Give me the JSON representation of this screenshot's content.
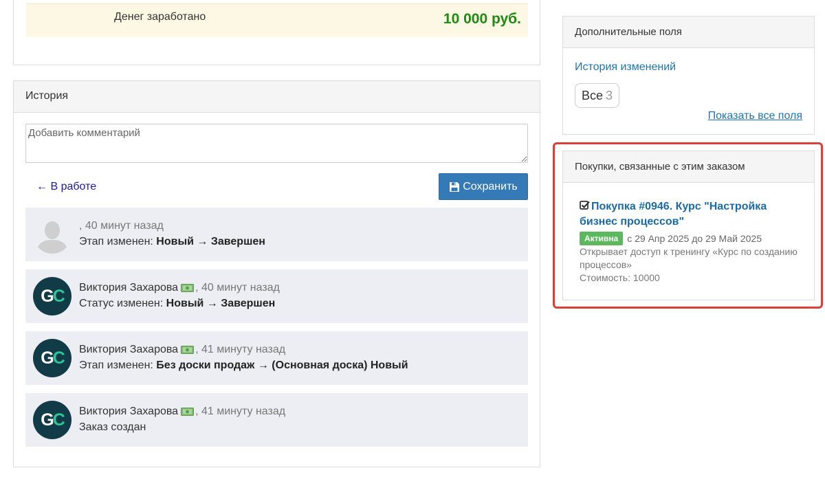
{
  "earnings": {
    "label": "Денег заработано",
    "value": "10 000 руб."
  },
  "history": {
    "title": "История",
    "comment_placeholder": "Добавить комментарий",
    "back_link": "← В работе",
    "save_label": "Сохранить",
    "events": [
      {
        "author": "",
        "time": ", 40 минут назад",
        "action_prefix": "Этап изменен: ",
        "action_value": "Новый → Завершен",
        "avatar": "default-user"
      },
      {
        "author": "Виктория Захарова",
        "time": ", 40 минут назад",
        "action_prefix": "Статус изменен: ",
        "action_value": "Новый → Завершен",
        "avatar": "GC"
      },
      {
        "author": "Виктория Захарова",
        "time": ", 41 минуту назад",
        "action_prefix": "Этап изменен: ",
        "action_value": "Без доски продаж → (Основная доска) Новый",
        "avatar": "GC"
      },
      {
        "author": "Виктория Захарова",
        "time": ", 41 минуту назад",
        "action_prefix": "Заказ создан",
        "action_value": "",
        "avatar": "GC"
      }
    ]
  },
  "extra_fields": {
    "title": "Дополнительные поля",
    "history_link": "История изменений",
    "all_label": "Все",
    "all_count": "3",
    "show_all_link": "Показать все поля"
  },
  "purchases": {
    "title": "Покупки, связанные с этим заказом",
    "item": {
      "name": "Покупка #0946. Курс \"Настройка бизнес процессов\"",
      "status": "Активна",
      "period": "с 29 Апр 2025 до 29 Май 2025",
      "description": "Открывает доступ к тренингу «Курс по созданию процессов»",
      "cost": "Стоимость: 10000"
    }
  },
  "colors": {
    "accent": "#337ab7",
    "money_green": "#1e8a14",
    "link": "#1a74b8",
    "highlight": "#d9403a",
    "badge_active": "#5cb85c"
  }
}
